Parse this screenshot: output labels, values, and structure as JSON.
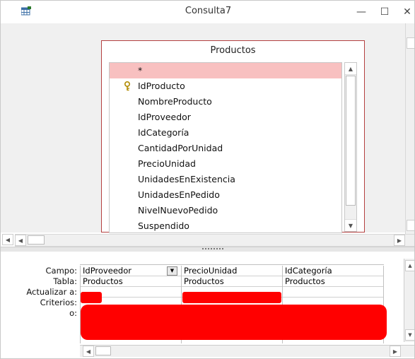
{
  "window": {
    "title": "Consulta7",
    "minimize_glyph": "—",
    "maximize_glyph": "☐",
    "close_glyph": "✕",
    "icon": "query-icon"
  },
  "table": {
    "name": "Productos",
    "fields": [
      {
        "label": "*",
        "primary_key": false,
        "highlighted": true
      },
      {
        "label": "IdProducto",
        "primary_key": true,
        "highlighted": false
      },
      {
        "label": "NombreProducto",
        "primary_key": false,
        "highlighted": false
      },
      {
        "label": "IdProveedor",
        "primary_key": false,
        "highlighted": false
      },
      {
        "label": "IdCategoría",
        "primary_key": false,
        "highlighted": false
      },
      {
        "label": "CantidadPorUnidad",
        "primary_key": false,
        "highlighted": false
      },
      {
        "label": "PrecioUnidad",
        "primary_key": false,
        "highlighted": false
      },
      {
        "label": "UnidadesEnExistencia",
        "primary_key": false,
        "highlighted": false
      },
      {
        "label": "UnidadesEnPedido",
        "primary_key": false,
        "highlighted": false
      },
      {
        "label": "NivelNuevoPedido",
        "primary_key": false,
        "highlighted": false
      },
      {
        "label": "Suspendido",
        "primary_key": false,
        "highlighted": false
      }
    ]
  },
  "grid": {
    "row_labels": {
      "campo": "Campo:",
      "tabla": "Tabla:",
      "actualizar": "Actualizar a:",
      "criterios": "Criterios:",
      "o": "o:"
    },
    "columns": [
      {
        "campo": "IdProveedor",
        "tabla": "Productos"
      },
      {
        "campo": "PrecioUnidad",
        "tabla": "Productos"
      },
      {
        "campo": "IdCategoría",
        "tabla": "Productos"
      }
    ]
  },
  "colors": {
    "highlight_row": "#f8c0c0",
    "table_border": "#b44040",
    "redaction": "#ff0000"
  }
}
